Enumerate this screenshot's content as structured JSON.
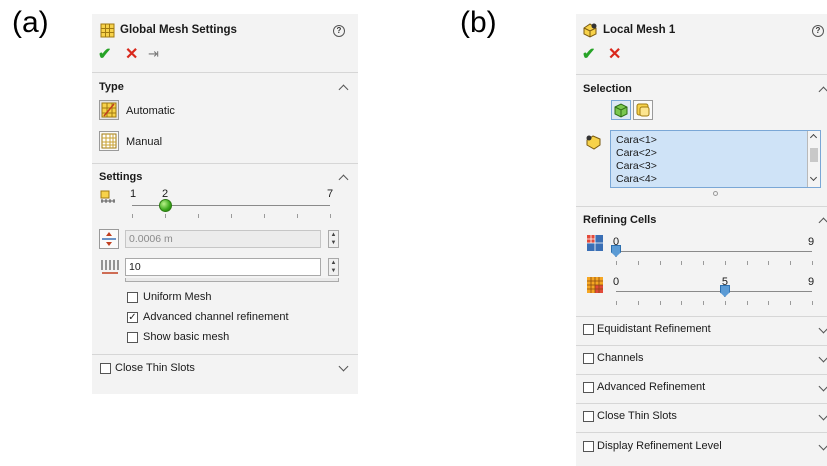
{
  "labels": {
    "a": "(a)",
    "b": "(b)"
  },
  "global_mesh": {
    "title": "Global Mesh Settings",
    "help_glyph": "?",
    "ok_glyph": "✔",
    "cancel_glyph": "✕",
    "pin_glyph": "⇥",
    "type_section": "Type",
    "type_automatic": "Automatic",
    "type_manual": "Manual",
    "settings_section": "Settings",
    "level_slider": {
      "min_label": "1",
      "value_label": "2",
      "max_label": "7",
      "min": 1,
      "max": 7,
      "value": 2
    },
    "gap_field": "0.0006 m",
    "cells_field": "10",
    "uniform_mesh": "Uniform Mesh",
    "advanced_channel": "Advanced channel refinement",
    "advanced_channel_check": "✓",
    "show_basic_mesh": "Show basic mesh",
    "close_thin_slots": "Close Thin Slots"
  },
  "local_mesh": {
    "title": "Local Mesh 1",
    "help_glyph": "?",
    "ok_glyph": "✔",
    "cancel_glyph": "✕",
    "selection_section": "Selection",
    "selection_items": [
      "Cara<1>",
      "Cara<2>",
      "Cara<3>",
      "Cara<4>"
    ],
    "refining_section": "Refining Cells",
    "slider1": {
      "min_label": "0",
      "value_label": "0",
      "max_label": "9",
      "min": 0,
      "max": 9,
      "value": 0
    },
    "slider2": {
      "min_label": "0",
      "value_label": "5",
      "max_label": "9",
      "min": 0,
      "max": 9,
      "value": 5
    },
    "equidistant": "Equidistant Refinement",
    "channels": "Channels",
    "advanced_refinement": "Advanced Refinement",
    "close_thin_slots": "Close Thin Slots",
    "display_level": "Display Refinement Level"
  },
  "colors": {
    "ok": "#27a327",
    "cancel": "#d9281c",
    "panel": "#f3f3f3",
    "selection": "#cfe3f7"
  }
}
